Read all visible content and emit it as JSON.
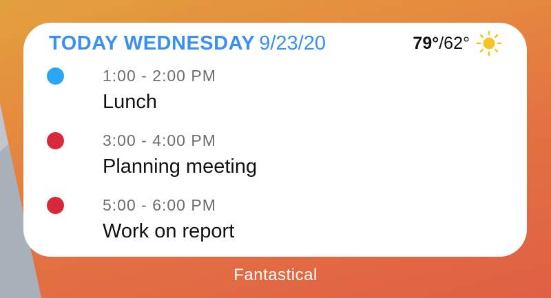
{
  "wallpaper": {
    "colors": [
      "#e3a03e",
      "#e37242",
      "#e05f45",
      "#a9b0b9"
    ]
  },
  "widget": {
    "header": {
      "day_label": "TODAY WEDNESDAY",
      "date": "9/23/20",
      "accent_color": "#3b8ff0"
    },
    "weather": {
      "high": "79°",
      "low": "/62°",
      "icon": "sun-icon",
      "icon_color": "#f5c523"
    },
    "events": [
      {
        "time": "1:00 - 2:00 PM",
        "title": "Lunch",
        "color": "#2aa6f5"
      },
      {
        "time": "3:00 - 4:00 PM",
        "title": "Planning meeting",
        "color": "#d9283a"
      },
      {
        "time": "5:00 - 6:00 PM",
        "title": "Work on report",
        "color": "#d9283a"
      }
    ]
  },
  "widget_name": "Fantastical"
}
